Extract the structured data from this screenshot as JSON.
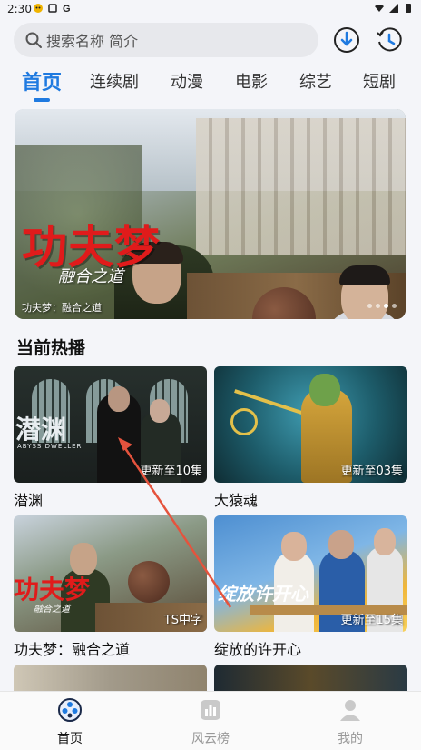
{
  "status_bar": {
    "time": "2:30"
  },
  "search": {
    "placeholder": "搜索名称 简介"
  },
  "tabs": [
    {
      "label": "首页",
      "active": true
    },
    {
      "label": "连续剧",
      "active": false
    },
    {
      "label": "动漫",
      "active": false
    },
    {
      "label": "电影",
      "active": false
    },
    {
      "label": "综艺",
      "active": false
    },
    {
      "label": "短剧",
      "active": false
    }
  ],
  "banner": {
    "title": "功夫梦",
    "subtitle": "融合之道",
    "caption": "功夫梦：融合之道"
  },
  "section": {
    "title": "当前热播"
  },
  "cards": [
    {
      "title": "潜渊",
      "badge": "更新至10集",
      "logo": "潜渊",
      "logo_sub": "ABYSS DWELLER"
    },
    {
      "title": "大猿魂",
      "badge": "更新至03集"
    },
    {
      "title": "功夫梦：融合之道",
      "badge": "TS中字",
      "logo": "功夫梦",
      "logo_sub": "融合之道"
    },
    {
      "title": "绽放的许开心",
      "badge": "更新至15集",
      "logo": "绽放许开心"
    }
  ],
  "bottom_nav": [
    {
      "label": "首页",
      "icon": "home-film-icon",
      "active": true
    },
    {
      "label": "风云榜",
      "icon": "chart-icon",
      "active": false
    },
    {
      "label": "我的",
      "icon": "profile-icon",
      "active": false
    }
  ],
  "colors": {
    "accent": "#1f7ae0",
    "title_red": "#e01b1b",
    "arrow": "#e5533d"
  }
}
